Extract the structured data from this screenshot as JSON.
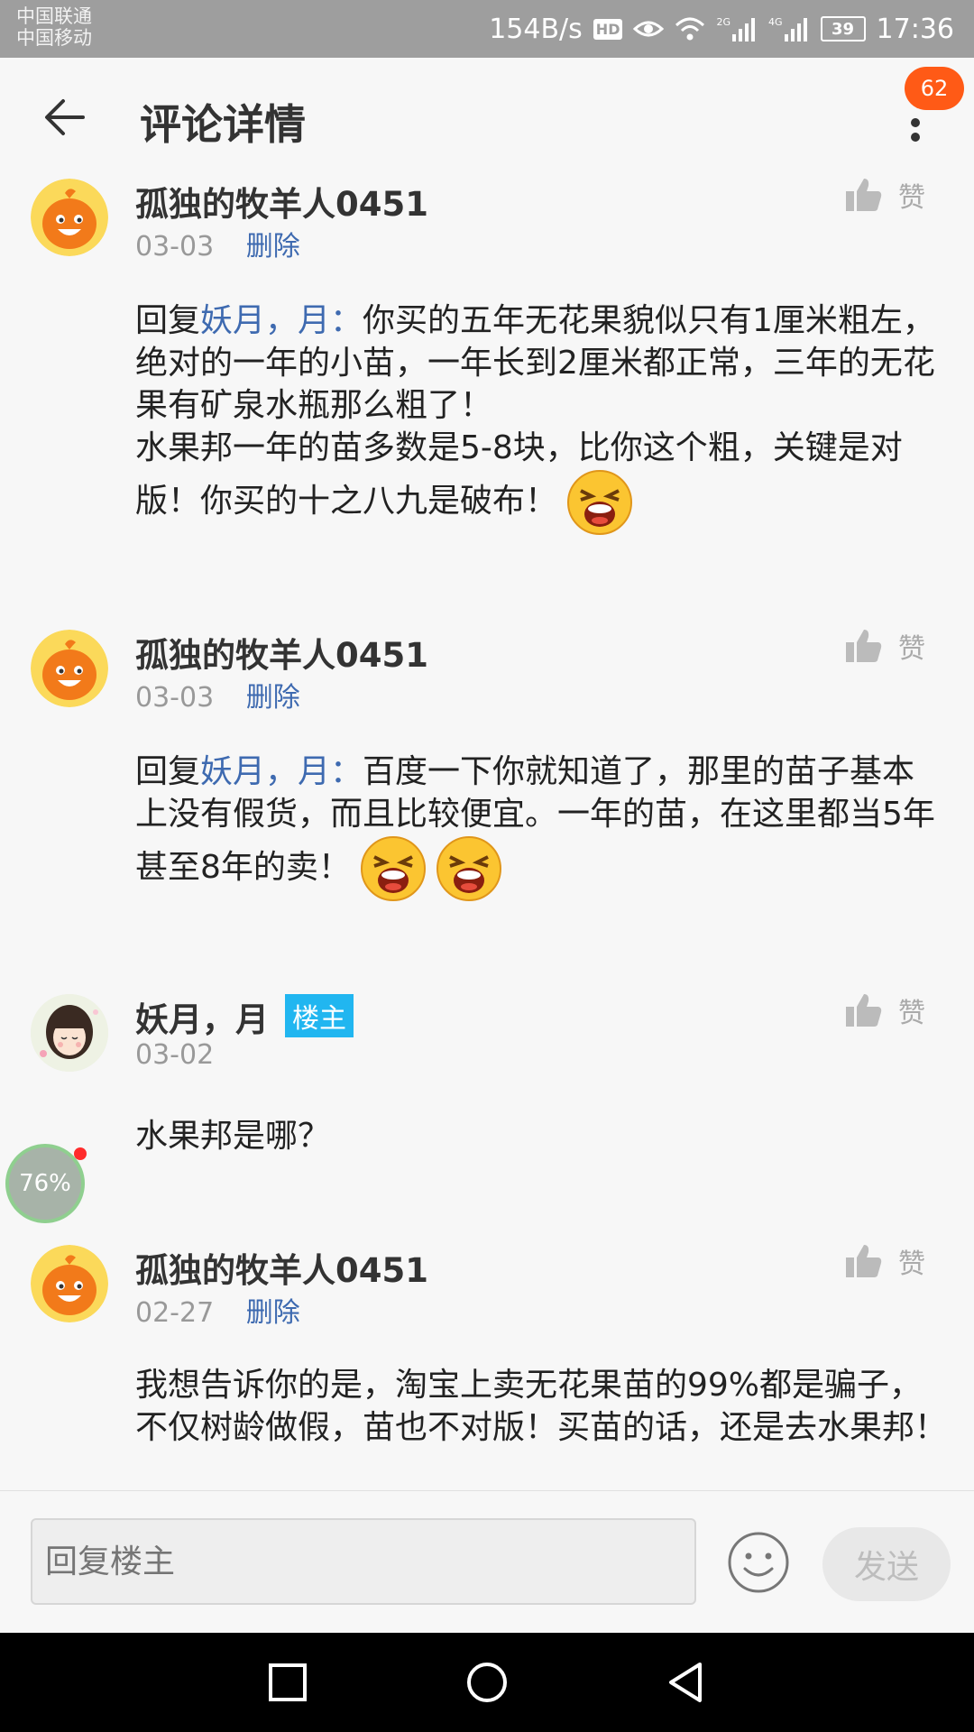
{
  "status_bar": {
    "carrier1": "中国联通",
    "carrier2": "中国移动",
    "speed": "154B/s",
    "hd": "HD",
    "net1": "2G",
    "net2": "4G",
    "battery": "39",
    "time": "17:36"
  },
  "header": {
    "title": "评论详情",
    "badge": "62"
  },
  "comments": [
    {
      "author": "孤独的牧羊人0451",
      "date": "03-03",
      "delete_label": "删除",
      "like_label": "赞",
      "reply_prefix": "回复",
      "reply_to": "妖月，月：",
      "text": "你买的五年无花果貌似只有1厘米粗左，绝对的一年的小苗，一年长到2厘米都正常，三年的无花果有矿泉水瓶那么粗了！",
      "text2": "水果邦一年的苗多数是5-8块，比你这个粗，关键是对版！你买的十之八九是破布！"
    },
    {
      "author": "孤独的牧羊人0451",
      "date": "03-03",
      "delete_label": "删除",
      "like_label": "赞",
      "reply_prefix": "回复",
      "reply_to": "妖月，月：",
      "text": "百度一下你就知道了，那里的苗子基本上没有假货，而且比较便宜。一年的苗，在这里都当5年甚至8年的卖！"
    },
    {
      "author": "妖月，月",
      "owner_tag": "楼主",
      "date": "03-02",
      "like_label": "赞",
      "text": "水果邦是哪？"
    },
    {
      "author": "孤独的牧羊人0451",
      "date": "02-27",
      "delete_label": "删除",
      "like_label": "赞",
      "text": "我想告诉你的是，淘宝上卖无花果苗的99%都是骗子，不仅树龄做假，苗也不对版！买苗的话，还是去水果邦！"
    }
  ],
  "floating": {
    "progress": "76%"
  },
  "input_bar": {
    "placeholder": "回复楼主",
    "send_label": "发送"
  }
}
